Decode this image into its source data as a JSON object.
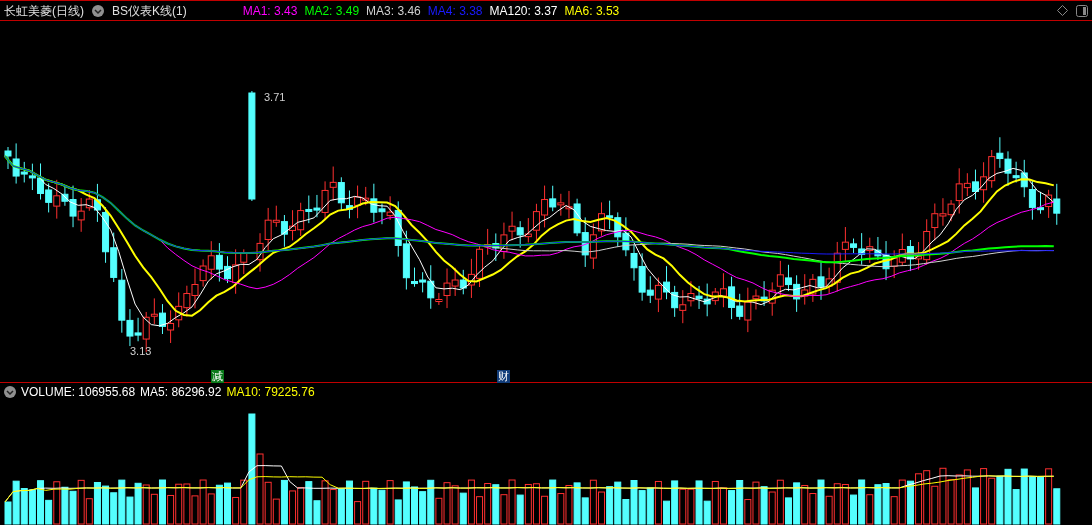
{
  "header": {
    "title": "长虹美菱(日线)",
    "indicator": "BS仪表K线(1)",
    "legend": [
      {
        "label": "MA1: 3.43",
        "color": "#ff00ff"
      },
      {
        "label": "MA2: 3.49",
        "color": "#00ff00"
      },
      {
        "label": "MA3: 3.46",
        "color": "#d0d0d0"
      },
      {
        "label": "MA4: 3.38",
        "color": "#1a1aff"
      },
      {
        "label": "MA120: 3.37",
        "color": "#ffffff"
      },
      {
        "label": "MA6: 3.53",
        "color": "#ffff00"
      }
    ]
  },
  "price_chart": {
    "high_label": "3.71",
    "low_label": "3.13",
    "markers": [
      {
        "label": "减",
        "color": "#0a7a1a"
      },
      {
        "label": "财",
        "color": "#123d7a"
      }
    ]
  },
  "volume": {
    "legend": [
      {
        "label": "VOLUME: 106955.68",
        "color": "#ffffff"
      },
      {
        "label": "MA5: 86296.92",
        "color": "#ffffff"
      },
      {
        "label": "MA10: 79225.76",
        "color": "#ffff00"
      }
    ]
  }
}
